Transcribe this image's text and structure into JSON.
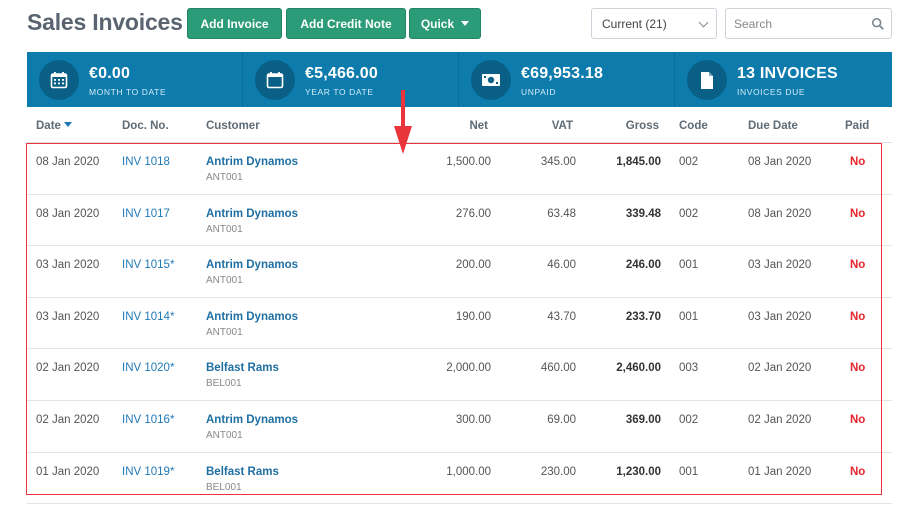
{
  "header": {
    "title": "Sales Invoices",
    "buttons": {
      "add_invoice": "Add Invoice",
      "add_credit_note": "Add Credit Note",
      "quick": "Quick"
    },
    "filter": {
      "selected": "Current (21)"
    },
    "search": {
      "placeholder": "Search"
    }
  },
  "summary": [
    {
      "value": "€0.00",
      "label": "MONTH TO DATE",
      "icon": "calendar-grid-icon"
    },
    {
      "value": "€5,466.00",
      "label": "YEAR TO DATE",
      "icon": "calendar-icon"
    },
    {
      "value": "€69,953.18",
      "label": "UNPAID",
      "icon": "banknote-icon"
    },
    {
      "value": "13 INVOICES",
      "label": "INVOICES DUE",
      "icon": "document-icon"
    }
  ],
  "table": {
    "columns": {
      "date": "Date",
      "doc_no": "Doc. No.",
      "customer": "Customer",
      "net": "Net",
      "vat": "VAT",
      "gross": "Gross",
      "code": "Code",
      "due_date": "Due Date",
      "paid": "Paid"
    },
    "rows": [
      {
        "date": "08 Jan 2020",
        "doc": "INV 1018",
        "customer": "Antrim Dynamos",
        "customer_code": "ANT001",
        "net": "1,500.00",
        "vat": "345.00",
        "gross": "1,845.00",
        "code": "002",
        "due": "08 Jan 2020",
        "paid": "No"
      },
      {
        "date": "08 Jan 2020",
        "doc": "INV 1017",
        "customer": "Antrim Dynamos",
        "customer_code": "ANT001",
        "net": "276.00",
        "vat": "63.48",
        "gross": "339.48",
        "code": "002",
        "due": "08 Jan 2020",
        "paid": "No"
      },
      {
        "date": "03 Jan 2020",
        "doc": "INV 1015*",
        "customer": "Antrim Dynamos",
        "customer_code": "ANT001",
        "net": "200.00",
        "vat": "46.00",
        "gross": "246.00",
        "code": "001",
        "due": "03 Jan 2020",
        "paid": "No"
      },
      {
        "date": "03 Jan 2020",
        "doc": "INV 1014*",
        "customer": "Antrim Dynamos",
        "customer_code": "ANT001",
        "net": "190.00",
        "vat": "43.70",
        "gross": "233.70",
        "code": "001",
        "due": "03 Jan 2020",
        "paid": "No"
      },
      {
        "date": "02 Jan 2020",
        "doc": "INV 1020*",
        "customer": "Belfast Rams",
        "customer_code": "BEL001",
        "net": "2,000.00",
        "vat": "460.00",
        "gross": "2,460.00",
        "code": "003",
        "due": "02 Jan 2020",
        "paid": "No"
      },
      {
        "date": "02 Jan 2020",
        "doc": "INV 1016*",
        "customer": "Antrim Dynamos",
        "customer_code": "ANT001",
        "net": "300.00",
        "vat": "69.00",
        "gross": "369.00",
        "code": "002",
        "due": "02 Jan 2020",
        "paid": "No"
      },
      {
        "date": "01 Jan 2020",
        "doc": "INV 1019*",
        "customer": "Belfast Rams",
        "customer_code": "BEL001",
        "net": "1,000.00",
        "vat": "230.00",
        "gross": "1,230.00",
        "code": "001",
        "due": "01 Jan 2020",
        "paid": "No"
      }
    ]
  },
  "colors": {
    "brand_green": "#2c9b77",
    "summary_blue": "#0d7bab",
    "link_blue": "#1f7ab8",
    "unpaid_red": "#e8252d",
    "annotation_red": "#e8343a"
  }
}
